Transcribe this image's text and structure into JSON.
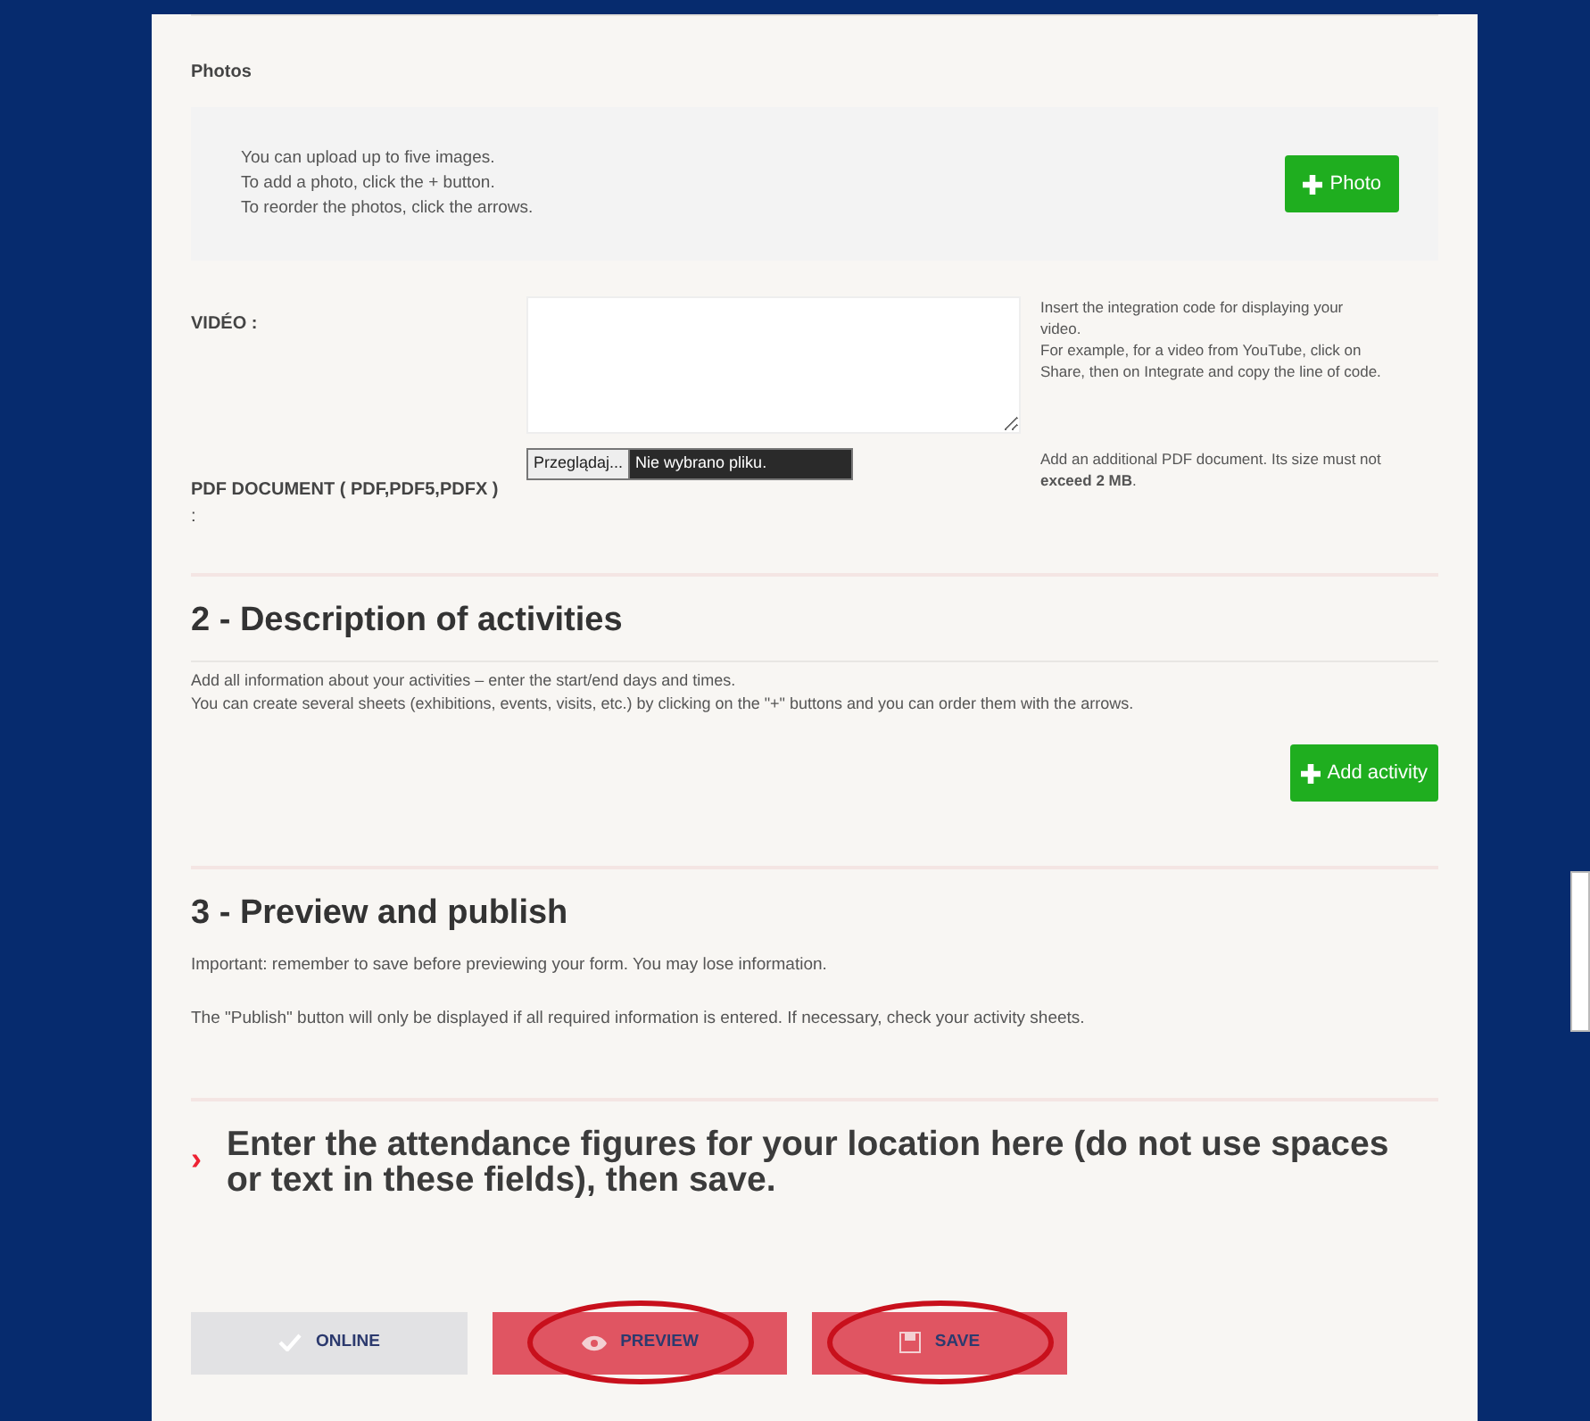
{
  "photos": {
    "label": "Photos",
    "help": [
      "You can upload up to five images.",
      "To add a photo, click the + button.",
      "To reorder the photos, click the arrows."
    ],
    "button": "Photo"
  },
  "video": {
    "label": "VIDÉO :",
    "help": "Insert the integration code for displaying your video.\nFor example, for a video from YouTube, click on Share, then on Integrate and copy the line of code."
  },
  "pdf": {
    "label": "PDF DOCUMENT ( PDF,PDF5,PDFX )",
    "colon": ":",
    "browse": "Przeglądaj...",
    "file": "Nie wybrano pliku.",
    "help": "Add an additional PDF document. Its size must not **exceed 2 MB**."
  },
  "section2": {
    "title": "2 - Description of activities",
    "lines": [
      "Add all information about your activities – enter the start/end days and times.",
      "You can create several sheets (exhibitions, events, visits, etc.) by clicking on the \"+\" buttons and you can order them with the arrows."
    ],
    "button": "Add activity"
  },
  "section3": {
    "title": "3 - Preview and publish",
    "lines": [
      "Important: remember to save before previewing your form. You may lose information.",
      "The \"Publish\" button will only be displayed if all required information is entered. If necessary, check your activity sheets."
    ]
  },
  "attendance": {
    "marker": "›",
    "text": "Enter the attendance figures for your location here (do not use spaces or text in these fields), then save."
  },
  "actions": [
    {
      "label": "ONLINE",
      "kind": "online",
      "circled": false
    },
    {
      "label": "PREVIEW",
      "kind": "preview",
      "circled": true
    },
    {
      "label": "SAVE",
      "kind": "save",
      "circled": true
    }
  ]
}
